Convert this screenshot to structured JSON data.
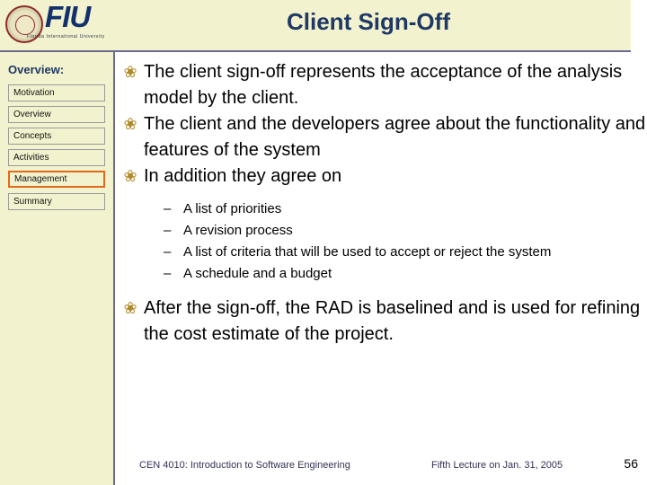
{
  "branding": {
    "logo_text": "FIU",
    "logo_subtitle": "Florida International University",
    "seal_icon": "university-seal-icon"
  },
  "header": {
    "title": "Client Sign-Off"
  },
  "sidebar": {
    "heading": "Overview:",
    "items": [
      {
        "label": "Motivation",
        "active": false
      },
      {
        "label": "Overview",
        "active": false
      },
      {
        "label": "Concepts",
        "active": false
      },
      {
        "label": "Activities",
        "active": false
      },
      {
        "label": "Management",
        "active": true
      },
      {
        "label": "Summary",
        "active": false
      }
    ]
  },
  "main": {
    "bullet_glyph": "❀",
    "dash_glyph": "–",
    "bullets": [
      "The client sign-off represents the acceptance of the analysis model by the client.",
      "The client and the developers agree about the functionality and features of the system",
      "In addition they agree on"
    ],
    "sub_bullets": [
      "A list of priorities",
      "A revision process",
      "A list of criteria that will be used to accept or reject the system",
      "A schedule and a budget"
    ],
    "closing_bullet": "After the sign-off, the RAD is baselined and is used for refining the cost estimate of the project."
  },
  "footer": {
    "course": "CEN 4010: Introduction to Software Engineering",
    "lecture": "Fifth Lecture on Jan. 31, 2005",
    "page_number": "56"
  },
  "colors": {
    "banner_bg": "#f2f2cf",
    "title_text": "#1f3864",
    "rule": "#6b6b8f",
    "active_nav_border": "#e06a1b",
    "bullet_gold": "#b08a28"
  }
}
